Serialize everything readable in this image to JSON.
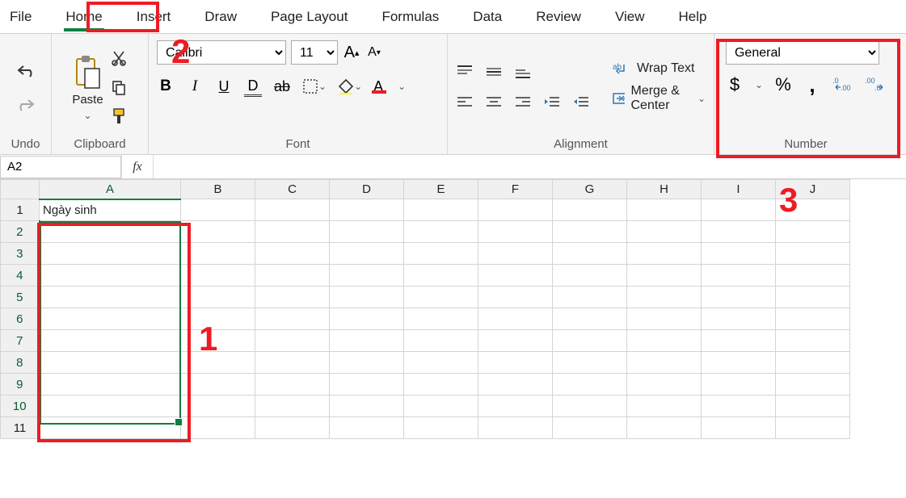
{
  "tabs": {
    "file": "File",
    "home": "Home",
    "insert": "Insert",
    "draw": "Draw",
    "page_layout": "Page Layout",
    "formulas": "Formulas",
    "data": "Data",
    "review": "Review",
    "view": "View",
    "help": "Help"
  },
  "ribbon": {
    "undo_label": "Undo",
    "clipboard": {
      "paste": "Paste",
      "label": "Clipboard"
    },
    "font": {
      "name": "Calibri",
      "size": "11",
      "label": "Font"
    },
    "alignment": {
      "wrap": "Wrap Text",
      "merge": "Merge & Center",
      "label": "Alignment"
    },
    "number": {
      "format": "General",
      "label": "Number"
    }
  },
  "fx": {
    "namebox": "A2",
    "symbol": "fx",
    "value": ""
  },
  "grid": {
    "cols": [
      "A",
      "B",
      "C",
      "D",
      "E",
      "F",
      "G",
      "H",
      "I",
      "J"
    ],
    "rows": [
      "1",
      "2",
      "3",
      "4",
      "5",
      "6",
      "7",
      "8",
      "9",
      "10",
      "11"
    ],
    "a1": "Ngày sinh"
  },
  "annotations": {
    "n1": "1",
    "n2": "2",
    "n3": "3"
  }
}
